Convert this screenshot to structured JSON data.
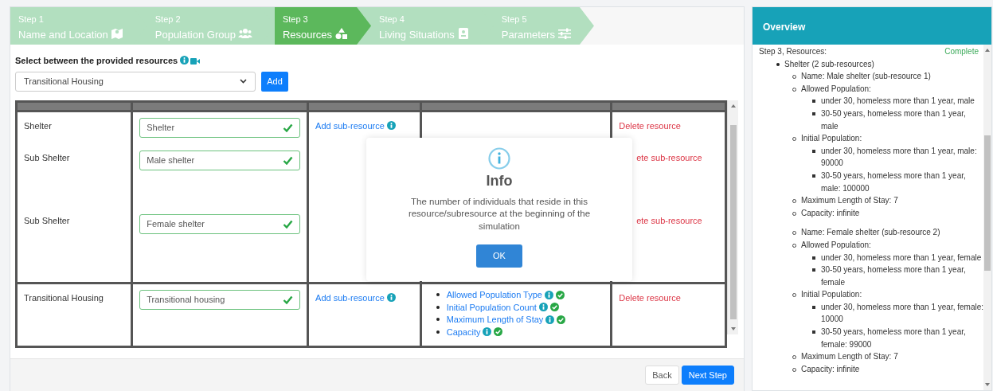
{
  "steps": [
    {
      "number": "Step 1",
      "title": "Name and Location",
      "selected": false
    },
    {
      "number": "Step 2",
      "title": "Population Group",
      "selected": false
    },
    {
      "number": "Step 3",
      "title": "Resources",
      "selected": true
    },
    {
      "number": "Step 4",
      "title": "Living Situations",
      "selected": false
    },
    {
      "number": "Step 5",
      "title": "Parameters",
      "selected": false
    }
  ],
  "resource_picker": {
    "label": "Select between the provided resources",
    "value": "Transitional Housing",
    "button": "Add"
  },
  "table": {
    "rows": [
      {
        "name": "Shelter",
        "field": "Shelter",
        "valid": true,
        "add_link": "Add sub-resource",
        "delete_link": "Delete resource",
        "sub_resources": [
          {
            "label": "Sub Shelter",
            "field": "Male shelter",
            "valid": true,
            "delete_link": "ete sub-resource"
          },
          {
            "label": "Sub Shelter",
            "field": "Female shelter",
            "valid": true,
            "delete_link": "ete sub-resource"
          }
        ]
      },
      {
        "name": "Transitional Housing",
        "field": "Transitional housing",
        "valid": true,
        "add_link": "Add sub-resource",
        "delete_link": "Delete resource",
        "parameters": [
          {
            "label": "Allowed Population Type",
            "done": true
          },
          {
            "label": "Initial Population Count",
            "done": true
          },
          {
            "label": "Maximum Length of Stay",
            "done": true
          },
          {
            "label": "Capacity",
            "done": true
          }
        ]
      }
    ]
  },
  "modal": {
    "title": "Info",
    "message": "The number of individuals that reside in this resource/subresource at the beginning of the simulation",
    "button": "OK"
  },
  "footer": {
    "buttons": [
      {
        "label": "Back",
        "kind": "secondary"
      },
      {
        "label": "Next Step",
        "kind": "primary"
      }
    ]
  },
  "overview": {
    "title": "Overview",
    "heading": "Step 3, Resources:",
    "status": "Complete",
    "items": [
      {
        "text": "Shelter (2 sub-resources)",
        "children": [
          {
            "text": "Name: Male shelter (sub-resource 1)"
          },
          {
            "text": "Allowed Population:",
            "children": [
              {
                "text": "under 30, homeless more than 1 year, male"
              },
              {
                "text": "30-50 years, homeless more than 1 year, male"
              }
            ]
          },
          {
            "text": "Initial Population:",
            "children": [
              {
                "text": "under 30, homeless more than 1 year, male: 90000"
              },
              {
                "text": "30-50 years, homeless more than 1 year, male: 100000"
              }
            ]
          },
          {
            "text": "Maximum Length of Stay: 7"
          },
          {
            "text": "Capacity: infinite"
          },
          {
            "text": "Name: Female shelter (sub-resource 2)",
            "separated": true
          },
          {
            "text": "Allowed Population:",
            "children": [
              {
                "text": "under 30, homeless more than 1 year, female"
              },
              {
                "text": "30-50 years, homeless more than 1 year, female"
              }
            ]
          },
          {
            "text": "Initial Population:",
            "children": [
              {
                "text": "under 30, homeless more than 1 year, female: 10000"
              },
              {
                "text": "30-50 years, homeless more than 1 year, female: 99000"
              }
            ]
          },
          {
            "text": "Maximum Length of Stay: 7"
          },
          {
            "text": "Capacity: infinite"
          }
        ]
      }
    ]
  }
}
